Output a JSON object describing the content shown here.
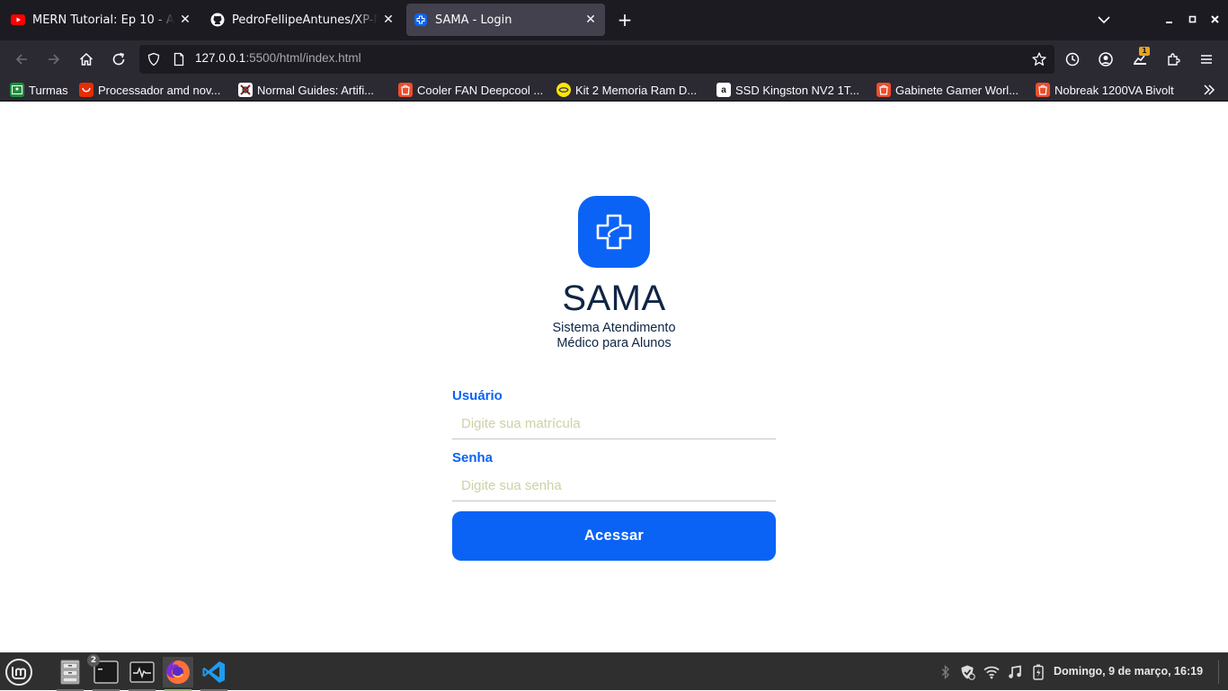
{
  "browser": {
    "tabs": [
      {
        "title": "MERN Tutorial: Ep 10 - Auth",
        "icon": "youtube-icon"
      },
      {
        "title": "PedroFellipeAntunes/XP-N2",
        "icon": "github-icon"
      },
      {
        "title": "SAMA - Login",
        "icon": "sama-favicon",
        "active": true
      }
    ],
    "url": {
      "host": "127.0.0.1",
      "rest": ":5500/html/index.html"
    },
    "bookmarks": [
      {
        "label": "Turmas",
        "icon": "google-classroom-icon",
        "color": "#1e8e3e"
      },
      {
        "label": "Processador amd nov...",
        "icon": "aliexpress-icon",
        "color": "#e62e04"
      },
      {
        "label": "Normal Guides: Artifi...",
        "icon": "normal-guides-icon",
        "color": "#ffffff"
      },
      {
        "label": "Cooler FAN Deepcool ...",
        "icon": "shopee-icon",
        "color": "#ee4d2d"
      },
      {
        "label": "Kit 2 Memoria Ram D...",
        "icon": "mercadolivre-icon",
        "color": "#ffe600"
      },
      {
        "label": "SSD Kingston NV2 1T...",
        "icon": "amazon-icon",
        "color": "#ffffff"
      },
      {
        "label": "Gabinete Gamer Worl...",
        "icon": "shopee-icon",
        "color": "#ee4d2d"
      },
      {
        "label": "Nobreak 1200VA Bivolt",
        "icon": "shopee-icon",
        "color": "#ee4d2d"
      }
    ],
    "extension_badge": "1"
  },
  "login": {
    "title": "SAMA",
    "subtitle_line1": "Sistema Atendimento",
    "subtitle_line2": "Médico para Alunos",
    "user_label": "Usuário",
    "user_placeholder": "Digite sua matrícula",
    "password_label": "Senha",
    "password_placeholder": "Digite sua senha",
    "submit_label": "Acessar",
    "accent_color": "#0b63f6",
    "text_color": "#0f2545"
  },
  "taskbar": {
    "terminal_badge": "2",
    "clock": "Domingo, 9 de março, 16:19"
  }
}
